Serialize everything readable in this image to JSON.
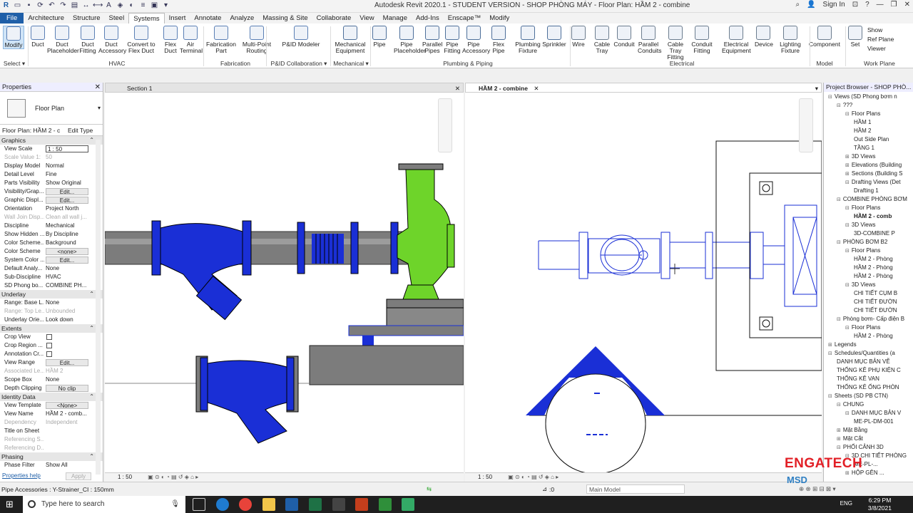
{
  "window": {
    "title": "Autodesk Revit 2020.1 - STUDENT VERSION - SHOP PHÒNG MÁY - Floor Plan: HẦM 2 - combine",
    "sign_in": "Sign In"
  },
  "ribbon_tabs": [
    "File",
    "Architecture",
    "Structure",
    "Steel",
    "Systems",
    "Insert",
    "Annotate",
    "Analyze",
    "Massing & Site",
    "Collaborate",
    "View",
    "Manage",
    "Add-Ins",
    "Enscape™",
    "Modify"
  ],
  "active_tab": "Systems",
  "ribbon": {
    "buttons": [
      {
        "label": "Modify",
        "icon": "cursor-icon"
      },
      {
        "label": "Duct",
        "icon": "duct-icon"
      },
      {
        "label": "Duct Placeholder",
        "icon": "duct-placeholder-icon"
      },
      {
        "label": "Duct Fitting",
        "icon": "duct-fitting-icon"
      },
      {
        "label": "Duct Accessory",
        "icon": "duct-accessory-icon"
      },
      {
        "label": "Convert to Flex Duct",
        "icon": "convert-flex-duct-icon"
      },
      {
        "label": "Flex Duct",
        "icon": "flex-duct-icon"
      },
      {
        "label": "Air Terminal",
        "icon": "air-terminal-icon"
      },
      {
        "label": "Fabrication Part",
        "icon": "fabrication-part-icon"
      },
      {
        "label": "Multi-Point Routing",
        "icon": "multi-point-routing-icon"
      },
      {
        "label": "P&ID Modeler",
        "icon": "pid-modeler-icon"
      },
      {
        "label": "Mechanical Equipment",
        "icon": "mechanical-equipment-icon"
      },
      {
        "label": "Pipe",
        "icon": "pipe-icon"
      },
      {
        "label": "Pipe Placeholder",
        "icon": "pipe-placeholder-icon"
      },
      {
        "label": "Parallel Pipes",
        "icon": "parallel-pipes-icon"
      },
      {
        "label": "Pipe Fitting",
        "icon": "pipe-fitting-icon"
      },
      {
        "label": "Pipe Accessory",
        "icon": "pipe-accessory-icon"
      },
      {
        "label": "Flex Pipe",
        "icon": "flex-pipe-icon"
      },
      {
        "label": "Plumbing Fixture",
        "icon": "plumbing-fixture-icon"
      },
      {
        "label": "Sprinkler",
        "icon": "sprinkler-icon"
      },
      {
        "label": "Wire",
        "icon": "wire-icon"
      },
      {
        "label": "Cable Tray",
        "icon": "cable-tray-icon"
      },
      {
        "label": "Conduit",
        "icon": "conduit-icon"
      },
      {
        "label": "Parallel Conduits",
        "icon": "parallel-conduits-icon"
      },
      {
        "label": "Cable Tray Fitting",
        "icon": "cable-tray-fitting-icon"
      },
      {
        "label": "Conduit Fitting",
        "icon": "conduit-fitting-icon"
      },
      {
        "label": "Electrical Equipment",
        "icon": "electrical-equipment-icon"
      },
      {
        "label": "Device",
        "icon": "device-icon"
      },
      {
        "label": "Lighting Fixture",
        "icon": "lighting-fixture-icon"
      },
      {
        "label": "Component",
        "icon": "component-icon"
      },
      {
        "label": "Set",
        "icon": "work-plane-set-icon"
      }
    ],
    "workplane_small": [
      "Show",
      "Ref Plane",
      "Viewer"
    ],
    "groups": [
      "Select ▾",
      "HVAC",
      "Fabrication",
      "P&ID Collaboration ▾",
      "Mechanical ▾",
      "Plumbing & Piping",
      "Electrical",
      "Model",
      "Work Plane"
    ]
  },
  "properties": {
    "title": "Properties",
    "type_name": "Floor Plan",
    "instance_label": "Floor Plan: HẦM 2 - c",
    "edit_type": "Edit Type",
    "sections": [
      {
        "name": "Graphics",
        "rows": [
          {
            "k": "View Scale",
            "v": "1 : 50",
            "style": "box"
          },
          {
            "k": "Scale Value 1:",
            "v": "50",
            "style": "dim"
          },
          {
            "k": "Display Model",
            "v": "Normal"
          },
          {
            "k": "Detail Level",
            "v": "Fine"
          },
          {
            "k": "Parts Visibility",
            "v": "Show Original"
          },
          {
            "k": "Visibility/Grap...",
            "v": "Edit...",
            "style": "btn"
          },
          {
            "k": "Graphic Displ...",
            "v": "Edit...",
            "style": "btn"
          },
          {
            "k": "Orientation",
            "v": "Project North"
          },
          {
            "k": "Wall Join Disp...",
            "v": "Clean all wall j...",
            "style": "dim"
          },
          {
            "k": "Discipline",
            "v": "Mechanical"
          },
          {
            "k": "Show Hidden ...",
            "v": "By Discipline"
          },
          {
            "k": "Color Scheme...",
            "v": "Background"
          },
          {
            "k": "Color Scheme",
            "v": "<none>",
            "style": "btn"
          },
          {
            "k": "System Color ...",
            "v": "Edit...",
            "style": "btn"
          },
          {
            "k": "Default Analy...",
            "v": "None"
          },
          {
            "k": "Sub-Discipline",
            "v": "HVAC"
          },
          {
            "k": "SD Phong bo...",
            "v": "COMBINE PH..."
          }
        ]
      },
      {
        "name": "Underlay",
        "rows": [
          {
            "k": "Range: Base L...",
            "v": "None"
          },
          {
            "k": "Range: Top Le...",
            "v": "Unbounded",
            "style": "dim"
          },
          {
            "k": "Underlay Orie...",
            "v": "Look down"
          }
        ]
      },
      {
        "name": "Extents",
        "rows": [
          {
            "k": "Crop View",
            "v": "",
            "style": "chk"
          },
          {
            "k": "Crop Region ...",
            "v": "",
            "style": "chk"
          },
          {
            "k": "Annotation Cr...",
            "v": "",
            "style": "chk"
          },
          {
            "k": "View Range",
            "v": "Edit...",
            "style": "btn"
          },
          {
            "k": "Associated Le...",
            "v": "HẦM 2",
            "style": "dim"
          },
          {
            "k": "Scope Box",
            "v": "None"
          },
          {
            "k": "Depth Clipping",
            "v": "No clip",
            "style": "btn"
          }
        ]
      },
      {
        "name": "Identity Data",
        "rows": [
          {
            "k": "View Template",
            "v": "<None>",
            "style": "btn"
          },
          {
            "k": "View Name",
            "v": "HẦM 2 - comb..."
          },
          {
            "k": "Dependency",
            "v": "Independent",
            "style": "dim"
          },
          {
            "k": "Title on Sheet",
            "v": ""
          },
          {
            "k": "Referencing S...",
            "v": "",
            "style": "dim"
          },
          {
            "k": "Referencing D...",
            "v": "",
            "style": "dim"
          }
        ]
      },
      {
        "name": "Phasing",
        "rows": [
          {
            "k": "Phase Filter",
            "v": "Show All"
          }
        ]
      }
    ],
    "help": "Properties help",
    "apply": "Apply"
  },
  "views": {
    "left_tab": "Section 1",
    "right_tab": "HẦM 2 - combine",
    "left_scale": "1 : 50",
    "right_scale": "1 : 50"
  },
  "browser": {
    "title": "Project Browser - SHOP PHÒ...",
    "nodes": [
      {
        "label": "Views (SD Phong bơm n",
        "level": 0,
        "toggle": "−"
      },
      {
        "label": "???",
        "level": 1,
        "toggle": "−"
      },
      {
        "label": "Floor Plans",
        "level": 2,
        "toggle": "−"
      },
      {
        "label": "HẦM 1",
        "level": 3
      },
      {
        "label": "HẦM 2",
        "level": 3
      },
      {
        "label": "Out Side Plan",
        "level": 3
      },
      {
        "label": "TẦNG 1",
        "level": 3
      },
      {
        "label": "3D Views",
        "level": 2,
        "toggle": "+"
      },
      {
        "label": "Elevations (Building",
        "level": 2,
        "toggle": "+"
      },
      {
        "label": "Sections (Building S",
        "level": 2,
        "toggle": "+"
      },
      {
        "label": "Drafting Views (Det",
        "level": 2,
        "toggle": "−"
      },
      {
        "label": "Drafting 1",
        "level": 3
      },
      {
        "label": "COMBINE PHÒNG BƠM",
        "level": 1,
        "toggle": "−"
      },
      {
        "label": "Floor Plans",
        "level": 2,
        "toggle": "−"
      },
      {
        "label": "HẦM 2 - comb",
        "level": 3,
        "bold": true
      },
      {
        "label": "3D Views",
        "level": 2,
        "toggle": "−"
      },
      {
        "label": "3D-COMBINE P",
        "level": 3
      },
      {
        "label": "PHÒNG BƠM B2",
        "level": 1,
        "toggle": "−"
      },
      {
        "label": "Floor Plans",
        "level": 2,
        "toggle": "−"
      },
      {
        "label": "HẦM 2 - Phòng",
        "level": 3
      },
      {
        "label": "HẦM 2 - Phòng",
        "level": 3
      },
      {
        "label": "HẦM 2 - Phòng",
        "level": 3
      },
      {
        "label": "3D Views",
        "level": 2,
        "toggle": "−"
      },
      {
        "label": "CHI TIẾT CỤM B",
        "level": 3
      },
      {
        "label": "CHI TIẾT ĐƯỜN",
        "level": 3
      },
      {
        "label": "CHI TIẾT ĐƯỜN",
        "level": 3
      },
      {
        "label": "Phòng bơm- Cấp điện B",
        "level": 1,
        "toggle": "−"
      },
      {
        "label": "Floor Plans",
        "level": 2,
        "toggle": "−"
      },
      {
        "label": "HẦM 2 - Phòng",
        "level": 3
      },
      {
        "label": "Legends",
        "level": 0,
        "toggle": "+"
      },
      {
        "label": "Schedules/Quantities (a",
        "level": 0,
        "toggle": "−"
      },
      {
        "label": "DANH MỤC BẢN VẼ",
        "level": 1
      },
      {
        "label": "THỐNG KÊ PHỤ KIỆN C",
        "level": 1
      },
      {
        "label": "THỐNG KÊ VAN",
        "level": 1
      },
      {
        "label": "THỐNG KÊ ỐNG PHÒN",
        "level": 1
      },
      {
        "label": "Sheets (SD PB CTN)",
        "level": 0,
        "toggle": "−"
      },
      {
        "label": "CHUNG",
        "level": 1,
        "toggle": "−"
      },
      {
        "label": "DANH MỤC BẢN V",
        "level": 2,
        "toggle": "−"
      },
      {
        "label": "ME-PL-DM-001",
        "level": 3
      },
      {
        "label": "Mặt Bằng",
        "level": 1,
        "toggle": "+"
      },
      {
        "label": "Mặt Cắt",
        "level": 1,
        "toggle": "+"
      },
      {
        "label": "PHỐI CẢNH 3D",
        "level": 1,
        "toggle": "−"
      },
      {
        "label": "3D CHI TIẾT PHÒNG",
        "level": 2,
        "toggle": "−"
      },
      {
        "label": "ME-PL-...",
        "level": 3
      },
      {
        "label": "HỘP GÊN ...",
        "level": 2,
        "toggle": "+"
      }
    ]
  },
  "status": {
    "message": "Pipe Accessories : Y-Strainer_CI : 150mm",
    "selection_count": ":0",
    "model": "Main Model"
  },
  "taskbar": {
    "search_placeholder": "Type here to search",
    "time": "6:29 PM",
    "date": "3/8/2021",
    "lang": "ENG"
  },
  "watermark": {
    "brand": "ENGATECH",
    "sub": "MSD"
  },
  "colors": {
    "pipe_blue": "#1a2fd6",
    "pump_green": "#6ed42a",
    "pipe_gray": "#7d7d7d",
    "revit_blue": "#1f5fa8"
  }
}
